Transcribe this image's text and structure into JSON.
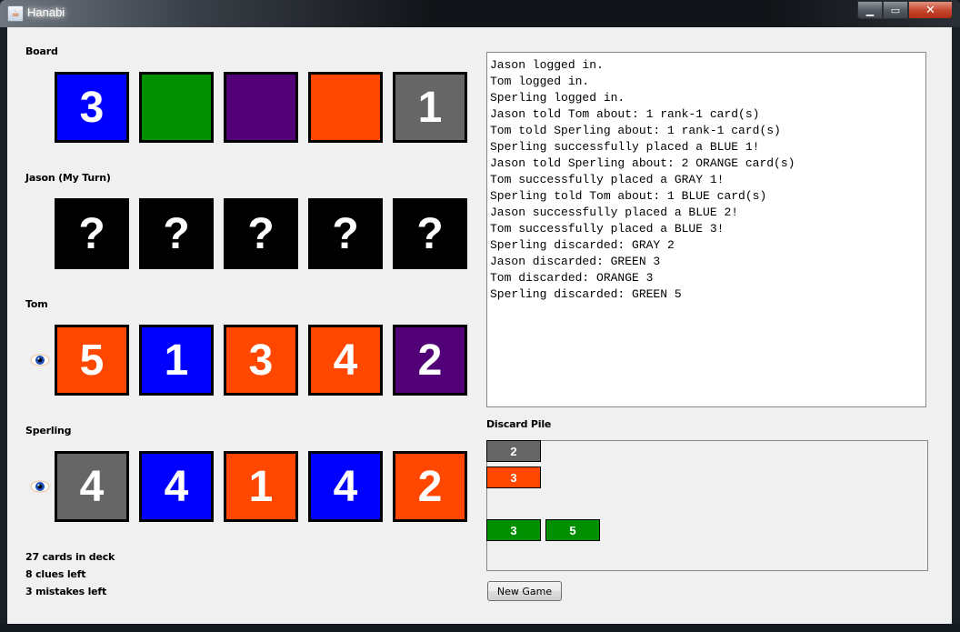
{
  "window": {
    "title": "Hanabi",
    "controls": [
      "minimize",
      "maximize",
      "close"
    ]
  },
  "colors": {
    "BLUE": "#0000ff",
    "GREEN": "#008f00",
    "PURPLE": "#520077",
    "ORANGE": "#ff4700",
    "GRAY": "#666666",
    "UNKNOWN": "#000000"
  },
  "board": {
    "label": "Board",
    "cards": [
      {
        "color": "BLUE",
        "rank": "3"
      },
      {
        "color": "GREEN",
        "rank": ""
      },
      {
        "color": "PURPLE",
        "rank": ""
      },
      {
        "color": "ORANGE",
        "rank": ""
      },
      {
        "color": "GRAY",
        "rank": "1"
      }
    ]
  },
  "players": [
    {
      "label": "Jason (My Turn)",
      "show_eye": false,
      "cards": [
        {
          "color": "UNKNOWN",
          "rank": "?"
        },
        {
          "color": "UNKNOWN",
          "rank": "?"
        },
        {
          "color": "UNKNOWN",
          "rank": "?"
        },
        {
          "color": "UNKNOWN",
          "rank": "?"
        },
        {
          "color": "UNKNOWN",
          "rank": "?"
        }
      ]
    },
    {
      "label": "Tom",
      "show_eye": true,
      "cards": [
        {
          "color": "ORANGE",
          "rank": "5"
        },
        {
          "color": "BLUE",
          "rank": "1"
        },
        {
          "color": "ORANGE",
          "rank": "3"
        },
        {
          "color": "ORANGE",
          "rank": "4"
        },
        {
          "color": "PURPLE",
          "rank": "2"
        }
      ]
    },
    {
      "label": "Sperling",
      "show_eye": true,
      "cards": [
        {
          "color": "GRAY",
          "rank": "4"
        },
        {
          "color": "BLUE",
          "rank": "4"
        },
        {
          "color": "ORANGE",
          "rank": "1"
        },
        {
          "color": "BLUE",
          "rank": "4"
        },
        {
          "color": "ORANGE",
          "rank": "2"
        }
      ]
    }
  ],
  "status": {
    "deck": "27 cards in deck",
    "clues": "8 clues left",
    "mistakes": "3 mistakes left"
  },
  "log": [
    "Jason logged in.",
    "Tom logged in.",
    "Sperling logged in.",
    "Jason told Tom about: 1 rank-1 card(s)",
    "Tom told Sperling about: 1 rank-1 card(s)",
    "Sperling successfully placed a BLUE 1!",
    "Jason told Sperling about: 2 ORANGE card(s)",
    "Tom successfully placed a GRAY 1!",
    "Sperling told Tom about: 1 BLUE card(s)",
    "Jason successfully placed a BLUE 2!",
    "Tom successfully placed a BLUE 3!",
    "Sperling discarded: GRAY 2",
    "Jason discarded: GREEN 3",
    "Tom discarded: ORANGE 3",
    "Sperling discarded: GREEN 5"
  ],
  "discard_pile": {
    "label": "Discard Pile",
    "rows": [
      {
        "color": "GRAY",
        "cards": [
          "2"
        ]
      },
      {
        "color": "ORANGE",
        "cards": [
          "3"
        ]
      },
      {
        "color": "PURPLE",
        "cards": []
      },
      {
        "color": "GREEN",
        "cards": [
          "3",
          "5"
        ]
      },
      {
        "color": "BLUE",
        "cards": []
      }
    ]
  },
  "new_game_label": "New Game"
}
